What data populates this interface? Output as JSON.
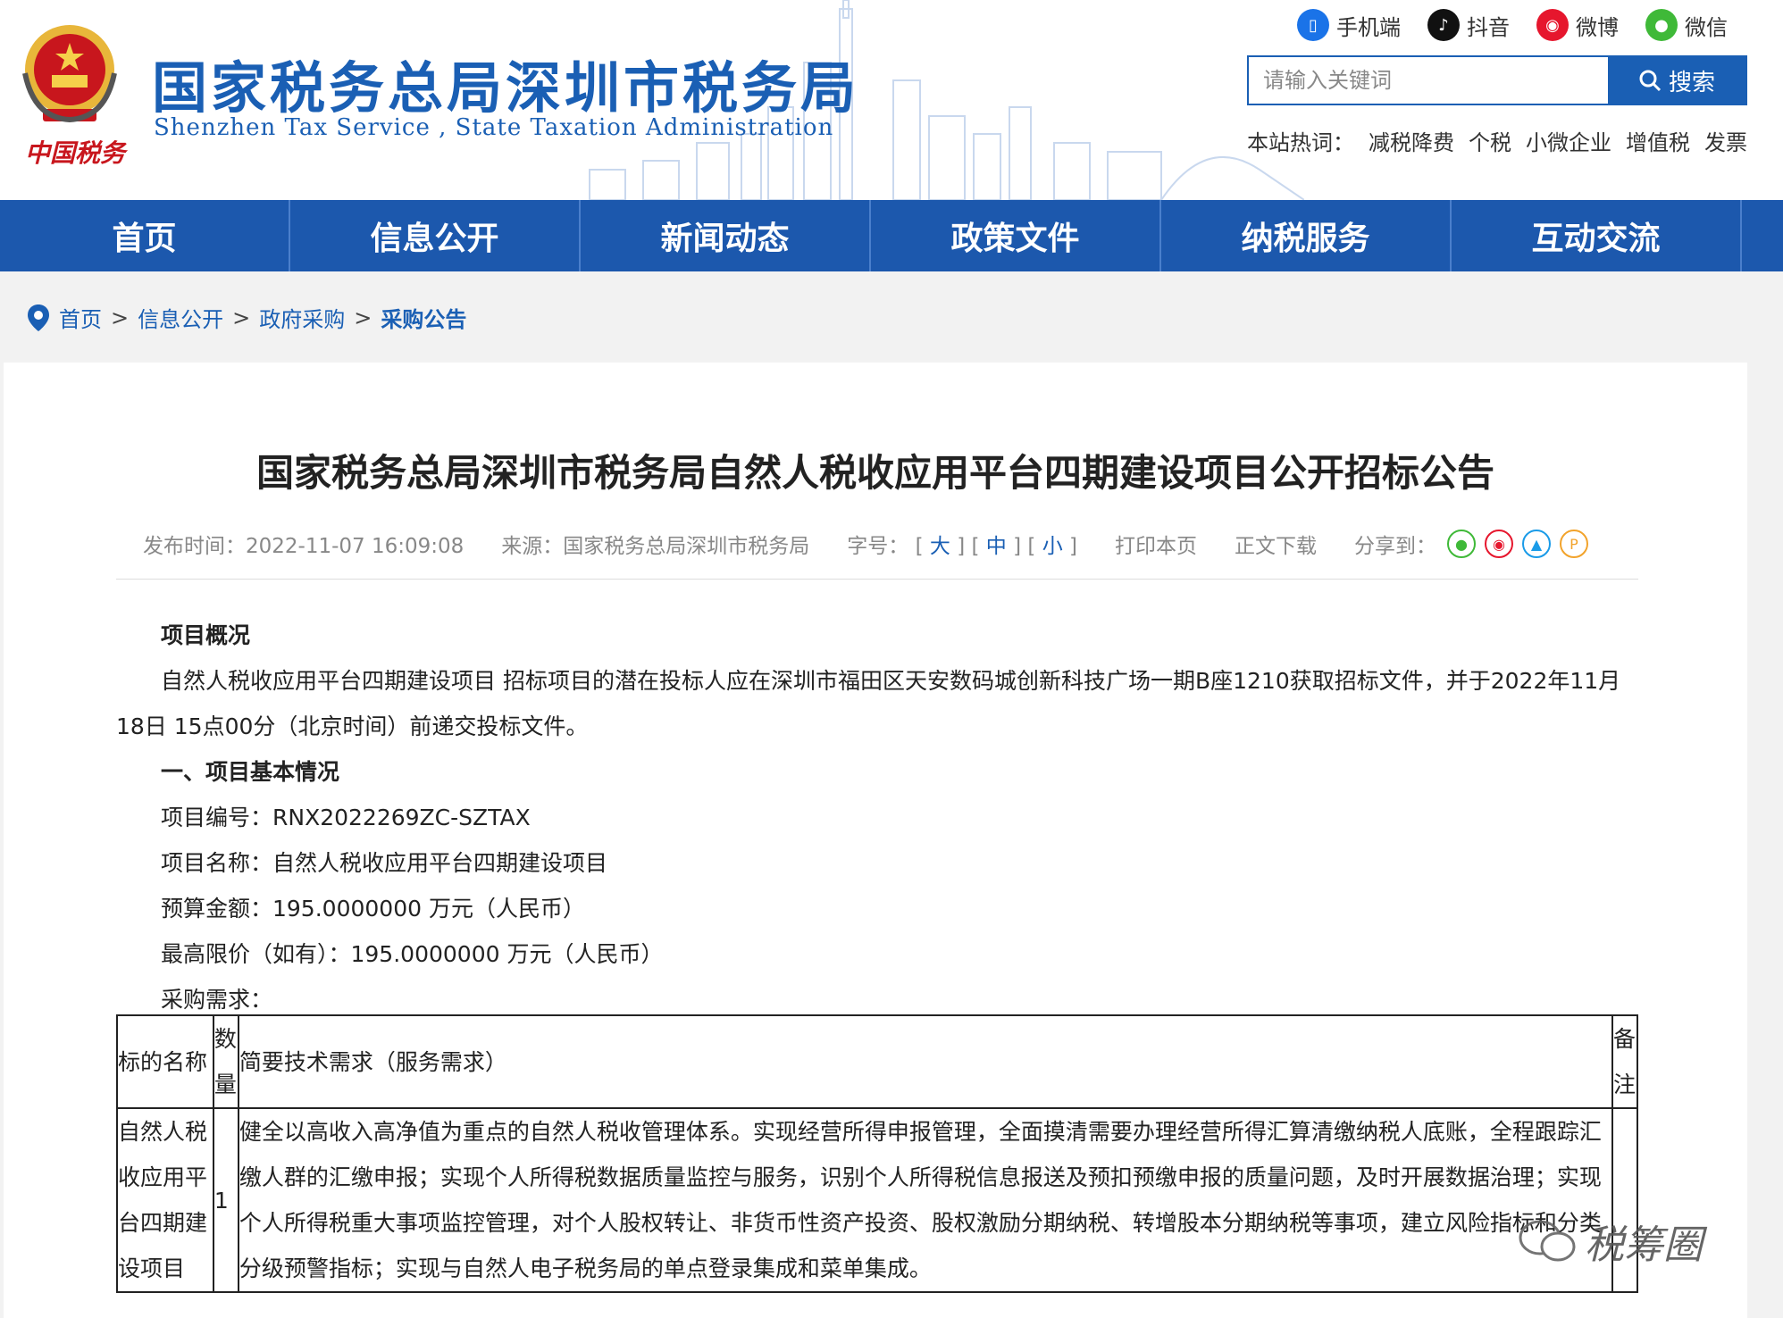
{
  "header": {
    "logo_text": "中国税务",
    "site_title": "国家税务总局深圳市税务局",
    "site_subtitle": "Shenzhen  Tax  Service ,  State  Taxation  Administration",
    "quick_links": [
      {
        "label": "手机端",
        "icon": "mobile-icon",
        "color": "#1a73e8"
      },
      {
        "label": "抖音",
        "icon": "tiktok-icon",
        "color": "#111111"
      },
      {
        "label": "微博",
        "icon": "weibo-icon",
        "color": "#e6162d"
      },
      {
        "label": "微信",
        "icon": "wechat-icon",
        "color": "#3fb938"
      }
    ],
    "search": {
      "placeholder": "请输入关键词",
      "button_label": "搜索"
    },
    "hot": {
      "label": "本站热词：",
      "words": [
        "减税降费",
        "个税",
        "小微企业",
        "增值税",
        "发票"
      ]
    }
  },
  "nav": {
    "items": [
      "首页",
      "信息公开",
      "新闻动态",
      "政策文件",
      "纳税服务",
      "互动交流"
    ]
  },
  "breadcrumb": {
    "items": [
      "首页",
      "信息公开",
      "政府采购"
    ],
    "current": "采购公告",
    "separator": ">"
  },
  "article": {
    "title": "国家税务总局深圳市税务局自然人税收应用平台四期建设项目公开招标公告",
    "meta": {
      "publish_label": "发布时间：",
      "publish_time": "2022-11-07 16:09:08",
      "source_label": "来源：",
      "source": "国家税务总局深圳市税务局",
      "font_size_label": "字号：",
      "font_sizes": [
        "大",
        "中",
        "小"
      ],
      "print_label": "打印本页",
      "download_label": "正文下载",
      "share_label": "分享到："
    },
    "share_icons": [
      {
        "name": "wechat-share-icon",
        "glyph": "●",
        "color": "#3fb938"
      },
      {
        "name": "weibo-share-icon",
        "glyph": "◉",
        "color": "#e6162d"
      },
      {
        "name": "qq-share-icon",
        "glyph": "▲",
        "color": "#1a9be8"
      },
      {
        "name": "qzone-share-icon",
        "glyph": "P",
        "color": "#f2a32b"
      }
    ],
    "section_overview": "项目概况",
    "overview_text": "自然人税收应用平台四期建设项目 招标项目的潜在投标人应在深圳市福田区天安数码城创新科技广场一期B座1210获取招标文件，并于2022年11月18日 15点00分（北京时间）前递交投标文件。",
    "section_basic": "一、项目基本情况",
    "project_no": "项目编号：RNX2022269ZC-SZTAX",
    "project_name": "项目名称：自然人税收应用平台四期建设项目",
    "budget": "预算金额：195.0000000 万元（人民币）",
    "max_price": "最高限价（如有）：195.0000000 万元（人民币）",
    "requirement_label": "采购需求：",
    "table": {
      "headers": [
        "标的名称",
        "数量",
        "简要技术需求（服务需求）",
        "备注"
      ],
      "rows": [
        {
          "name": "自然人税收应用平台四期建设项目",
          "qty": "1",
          "desc": "健全以高收入高净值为重点的自然人税收管理体系。实现经营所得申报管理，全面摸清需要办理经营所得汇算清缴纳税人底账，全程跟踪汇缴人群的汇缴申报；实现个人所得税数据质量监控与服务，识别个人所得税信息报送及预扣预缴申报的质量问题，及时开展数据治理；实现个人所得税重大事项监控管理，对个人股权转让、非货币性资产投资、股权激励分期纳税、转增股本分期纳税等事项，建立风险指标和分类分级预警指标；实现与自然人电子税务局的单点登录集成和菜单集成。",
          "note": ""
        }
      ]
    }
  },
  "watermark": {
    "text": "税筹圈"
  }
}
